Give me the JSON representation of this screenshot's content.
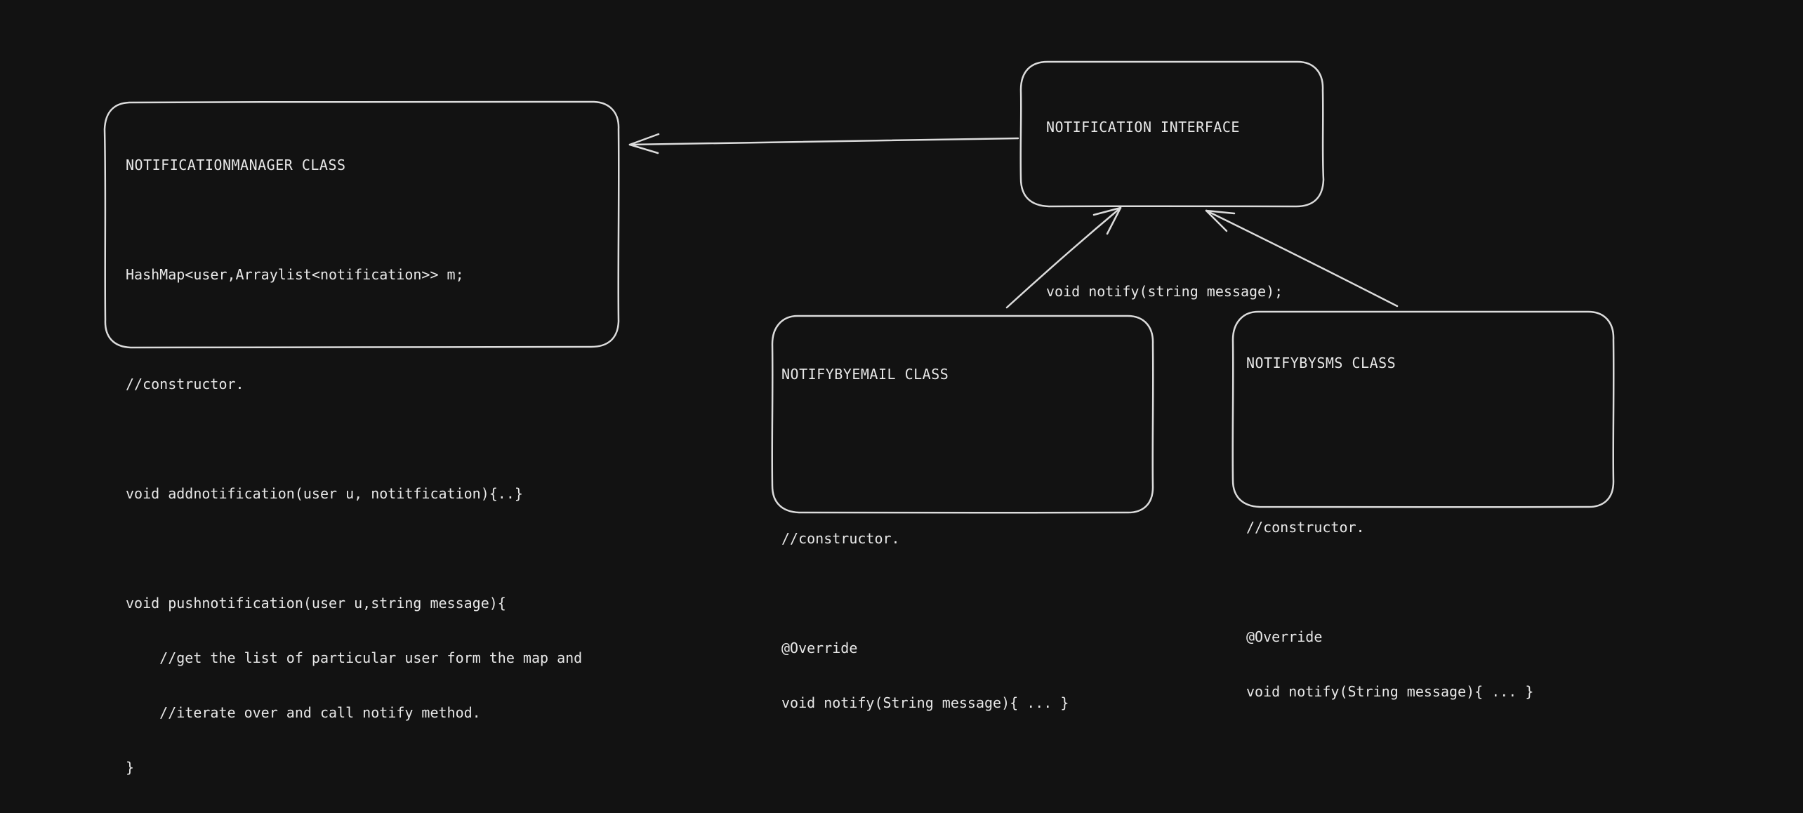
{
  "colors": {
    "background": "#121212",
    "stroke": "#dcdcdc",
    "text": "#e8e8e8"
  },
  "boxes": {
    "manager": {
      "title": "NOTIFICATIONMANAGER CLASS",
      "lines": [
        "",
        "HashMap<user,Arraylist<notification>> m;",
        "",
        "//constructor.",
        "",
        "void addnotification(user u, notitfication){..}",
        "",
        "void pushnotification(user u,string message){",
        "    //get the list of particular user form the map and",
        "    //iterate over and call notify method.",
        "}"
      ]
    },
    "interface": {
      "title": "NOTIFICATION INTERFACE",
      "lines": [
        "",
        "",
        "void notify(string message);"
      ]
    },
    "email": {
      "title": "NOTIFYBYEMAIL CLASS",
      "lines": [
        "",
        "",
        "//constructor.",
        "",
        "@Override",
        "void notify(String message){ ... }"
      ]
    },
    "sms": {
      "title": "NOTIFYBYSMS CLASS",
      "lines": [
        "",
        "",
        "//constructor.",
        "",
        "@Override",
        "void notify(String message){ ... }"
      ]
    }
  }
}
